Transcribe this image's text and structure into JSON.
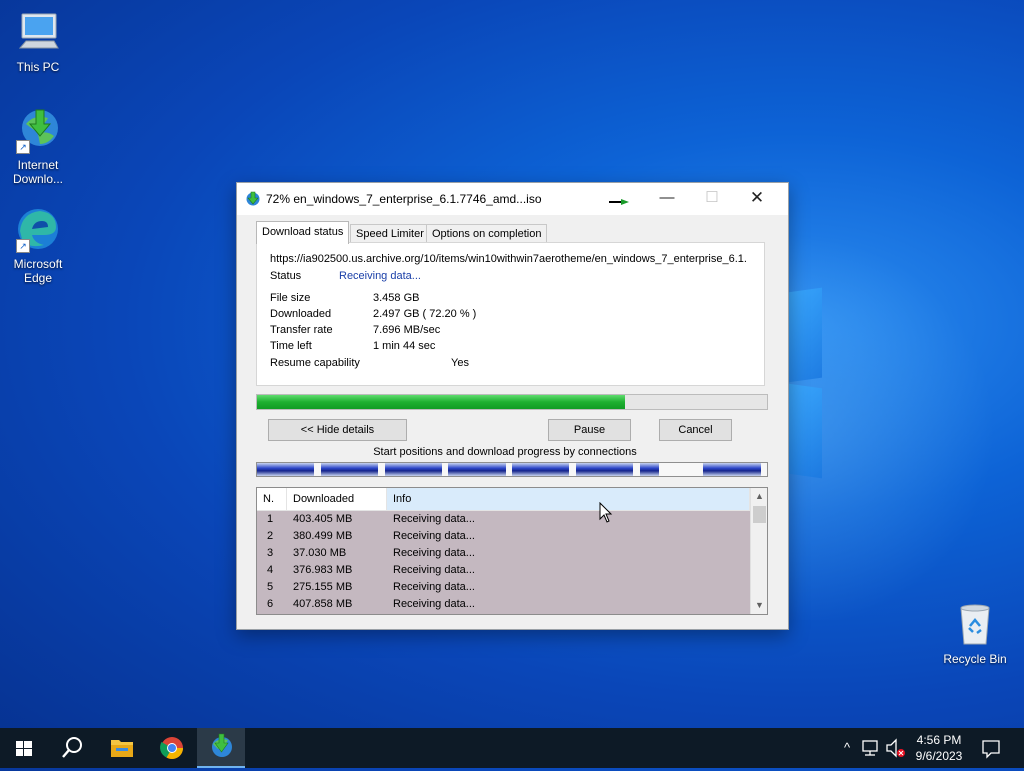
{
  "desktop": {
    "icons": [
      {
        "label": "This PC",
        "icon": "this-pc-icon"
      },
      {
        "label": "Internet\nDownlo...",
        "icon": "idm-icon"
      },
      {
        "label": "Microsoft\nEdge",
        "icon": "edge-icon"
      },
      {
        "label": "Recycle Bin",
        "icon": "recycle-bin-icon"
      }
    ]
  },
  "dialog": {
    "title": "72% en_windows_7_enterprise_6.1.7746_amd...iso",
    "window_controls": {
      "minimize": "—",
      "maximize": "☐",
      "close": "✕"
    },
    "tabs": [
      {
        "label": "Download status",
        "active": true
      },
      {
        "label": "Speed Limiter",
        "active": false
      },
      {
        "label": "Options on completion",
        "active": false
      }
    ],
    "url": "https://ia902500.us.archive.org/10/items/win10withwin7aerotheme/en_windows_7_enterprise_6.1.",
    "status_label": "Status",
    "status_value": "Receiving data...",
    "details": {
      "file_size_label": "File size",
      "file_size_value": "3.458  GB",
      "downloaded_label": "Downloaded",
      "downloaded_value": "2.497  GB  ( 72.20 % )",
      "transfer_rate_label": "Transfer rate",
      "transfer_rate_value": "7.696  MB/sec",
      "time_left_label": "Time left",
      "time_left_value": "1 min 44 sec",
      "resume_label": "Resume capability",
      "resume_value": "Yes"
    },
    "progress_percent": 72.2,
    "buttons": {
      "hide_details": "<< Hide details",
      "pause": "Pause",
      "cancel": "Cancel"
    },
    "connections_label": "Start positions and download progress by connections",
    "connections_progress": [
      0.9,
      0.9,
      0.9,
      0.9,
      0.9,
      0.9,
      0.3,
      0.9
    ],
    "table": {
      "columns": [
        "N.",
        "Downloaded",
        "Info"
      ],
      "rows": [
        [
          "1",
          "403.405  MB",
          "Receiving data..."
        ],
        [
          "2",
          "380.499  MB",
          "Receiving data..."
        ],
        [
          "3",
          "37.030  MB",
          "Receiving data..."
        ],
        [
          "4",
          "376.983  MB",
          "Receiving data..."
        ],
        [
          "5",
          "275.155  MB",
          "Receiving data..."
        ],
        [
          "6",
          "407.858  MB",
          "Receiving data..."
        ]
      ]
    }
  },
  "taskbar": {
    "items": [
      "start-icon",
      "search-icon",
      "file-explorer-icon",
      "chrome-icon",
      "idm-icon"
    ],
    "tray": {
      "chevron": "^",
      "time": "4:56 PM",
      "date": "9/6/2023"
    }
  },
  "colors": {
    "progress_green": "#1eb031",
    "status_blue": "#1a3fa8",
    "taskbar": "#0d1a26",
    "table_body": "#c4b8c0"
  }
}
